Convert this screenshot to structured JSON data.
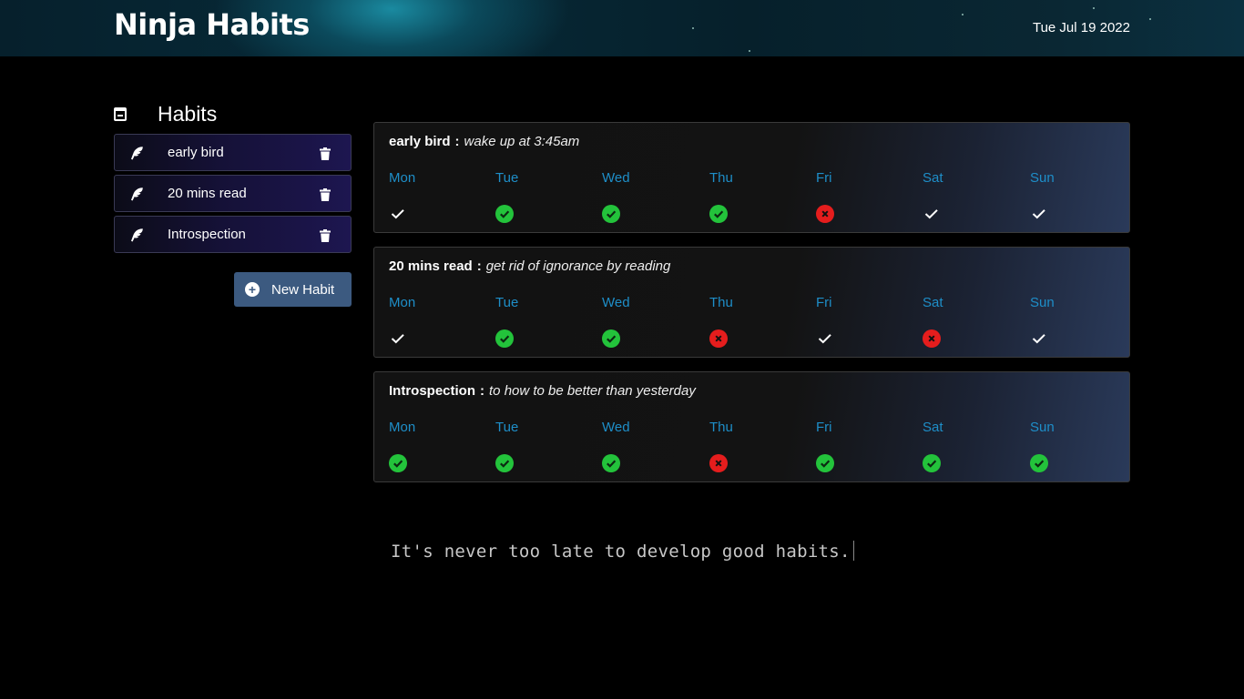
{
  "header": {
    "title": "Ninja Habits",
    "date": "Tue Jul 19 2022"
  },
  "sidebar": {
    "title": "Habits",
    "items": [
      {
        "label": "early bird",
        "icon": "feather-icon"
      },
      {
        "label": "20 mins read",
        "icon": "feather-icon"
      },
      {
        "label": "Introspection",
        "icon": "feather-icon"
      }
    ],
    "new_habit_label": "New Habit"
  },
  "days": [
    "Mon",
    "Tue",
    "Wed",
    "Thu",
    "Fri",
    "Sat",
    "Sun"
  ],
  "cards": [
    {
      "name": "early bird",
      "separator": ":",
      "description": "wake up at 3:45am",
      "statuses": [
        "check",
        "done",
        "done",
        "done",
        "fail",
        "check",
        "check"
      ]
    },
    {
      "name": "20 mins read",
      "separator": ":",
      "description": "get rid of ignorance by reading",
      "statuses": [
        "check",
        "done",
        "done",
        "fail",
        "check",
        "fail",
        "check"
      ]
    },
    {
      "name": "Introspection",
      "separator": ":",
      "description": "to how to be better than yesterday",
      "statuses": [
        "done",
        "done",
        "done",
        "fail",
        "done",
        "done",
        "done"
      ]
    }
  ],
  "quote": "It's never too late to develop good habits.",
  "colors": {
    "day_label": "#1e8ec8",
    "done": "#23c33b",
    "fail": "#e51d1d",
    "button": "#3c5a80"
  }
}
